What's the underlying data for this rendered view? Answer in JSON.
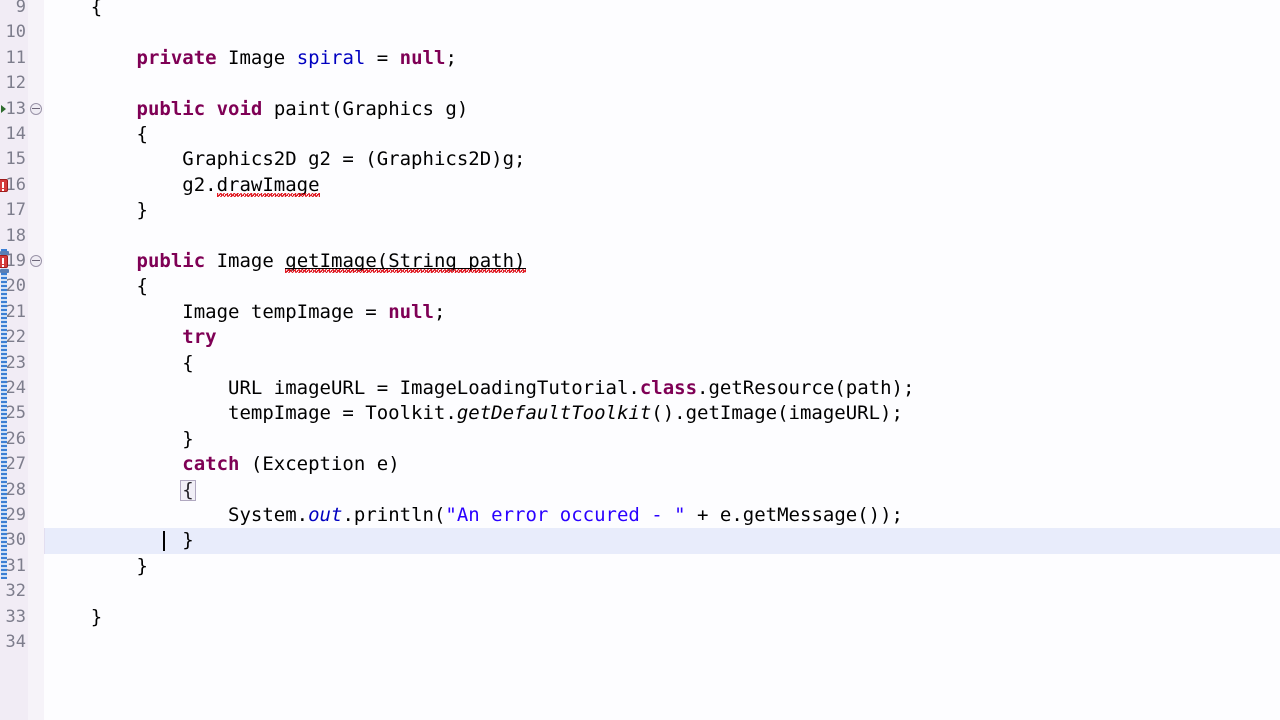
{
  "editor": {
    "app": "eclipse-java-editor",
    "language": "Java",
    "font_size_px": 19,
    "line_height_px": 25.4,
    "colors": {
      "background": "#fdfdff",
      "gutter_background": "#f1ecf5",
      "gutter_separator": "#e3dde9",
      "line_number": "#7d7d8c",
      "current_line_highlight": "#e8ecfb",
      "current_line_gutter": "#e2def0",
      "keyword": "#7f0055",
      "field": "#0000c0",
      "static_field": "#0000c0",
      "string": "#2a00ff",
      "plain_text": "#000000",
      "error_squiggle": "#e01b24",
      "error_marker": "#d43b3b",
      "change_bar": "#3b7fd4",
      "occurrence_marker": "#5a7fb5",
      "bracket_match_border": "#b0a8c0"
    },
    "current_line": 30,
    "caret_line": 30,
    "caret_column": 10,
    "change_bar_range": [
      19,
      31
    ]
  },
  "lines": [
    {
      "n": 9,
      "indent": 1,
      "tokens": [
        {
          "t": "{",
          "c": "plain"
        }
      ]
    },
    {
      "n": 10,
      "indent": 0,
      "tokens": []
    },
    {
      "n": 11,
      "indent": 2,
      "tokens": [
        {
          "t": "private",
          "c": "kw"
        },
        {
          "t": " ",
          "c": "plain"
        },
        {
          "t": "Image",
          "c": "plain"
        },
        {
          "t": " ",
          "c": "plain"
        },
        {
          "t": "spiral",
          "c": "field"
        },
        {
          "t": " = ",
          "c": "plain"
        },
        {
          "t": "null",
          "c": "kw"
        },
        {
          "t": ";",
          "c": "plain"
        }
      ]
    },
    {
      "n": 12,
      "indent": 0,
      "tokens": []
    },
    {
      "n": 13,
      "indent": 2,
      "fold": true,
      "arrow": true,
      "tokens": [
        {
          "t": "public",
          "c": "kw"
        },
        {
          "t": " ",
          "c": "plain"
        },
        {
          "t": "void",
          "c": "kw"
        },
        {
          "t": " ",
          "c": "plain"
        },
        {
          "t": "paint(Graphics g)",
          "c": "plain"
        }
      ]
    },
    {
      "n": 14,
      "indent": 2,
      "tokens": [
        {
          "t": "{",
          "c": "plain"
        }
      ]
    },
    {
      "n": 15,
      "indent": 3,
      "tokens": [
        {
          "t": "Graphics2D g2 = (Graphics2D)g;",
          "c": "plain"
        }
      ]
    },
    {
      "n": 16,
      "indent": 3,
      "error": true,
      "tokens": [
        {
          "t": "g2.",
          "c": "plain"
        },
        {
          "t": "drawImage",
          "c": "plain",
          "squiggle": true
        }
      ]
    },
    {
      "n": 17,
      "indent": 2,
      "tokens": [
        {
          "t": "}",
          "c": "plain"
        }
      ]
    },
    {
      "n": 18,
      "indent": 0,
      "tokens": []
    },
    {
      "n": 19,
      "indent": 2,
      "fold": true,
      "error": true,
      "occurrence": true,
      "tokens": [
        {
          "t": "public",
          "c": "kw"
        },
        {
          "t": " ",
          "c": "plain"
        },
        {
          "t": "Image",
          "c": "plain"
        },
        {
          "t": " ",
          "c": "plain"
        },
        {
          "t": "getImage(String path)",
          "c": "plain",
          "squiggle": true,
          "underline": true
        }
      ]
    },
    {
      "n": 20,
      "indent": 2,
      "tokens": [
        {
          "t": "{",
          "c": "plain"
        }
      ]
    },
    {
      "n": 21,
      "indent": 3,
      "tokens": [
        {
          "t": "Image tempImage = ",
          "c": "plain"
        },
        {
          "t": "null",
          "c": "kw"
        },
        {
          "t": ";",
          "c": "plain"
        }
      ]
    },
    {
      "n": 22,
      "indent": 3,
      "tokens": [
        {
          "t": "try",
          "c": "kw"
        }
      ]
    },
    {
      "n": 23,
      "indent": 3,
      "tokens": [
        {
          "t": "{",
          "c": "plain"
        }
      ]
    },
    {
      "n": 24,
      "indent": 4,
      "tokens": [
        {
          "t": "URL imageURL = ImageLoadingTutorial.",
          "c": "plain"
        },
        {
          "t": "class",
          "c": "kw"
        },
        {
          "t": ".getResource(path);",
          "c": "plain"
        }
      ]
    },
    {
      "n": 25,
      "indent": 4,
      "tokens": [
        {
          "t": "tempImage = Toolkit.",
          "c": "plain"
        },
        {
          "t": "getDefaultToolkit",
          "c": "smethod"
        },
        {
          "t": "().getImage(imageURL);",
          "c": "plain"
        }
      ]
    },
    {
      "n": 26,
      "indent": 3,
      "tokens": [
        {
          "t": "}",
          "c": "plain"
        }
      ]
    },
    {
      "n": 27,
      "indent": 3,
      "tokens": [
        {
          "t": "catch",
          "c": "kw"
        },
        {
          "t": " (Exception e)",
          "c": "plain"
        }
      ]
    },
    {
      "n": 28,
      "indent": 3,
      "bracket": true,
      "tokens": [
        {
          "t": "{",
          "c": "plain"
        }
      ]
    },
    {
      "n": 29,
      "indent": 4,
      "tokens": [
        {
          "t": "System.",
          "c": "plain"
        },
        {
          "t": "out",
          "c": "sfield"
        },
        {
          "t": ".println(",
          "c": "plain"
        },
        {
          "t": "\"An error occured - \"",
          "c": "str"
        },
        {
          "t": " + e.getMessage());",
          "c": "plain"
        }
      ]
    },
    {
      "n": 30,
      "indent": 3,
      "current": true,
      "tokens": [
        {
          "t": "}",
          "c": "plain"
        }
      ]
    },
    {
      "n": 31,
      "indent": 2,
      "tokens": [
        {
          "t": "}",
          "c": "plain"
        }
      ]
    },
    {
      "n": 32,
      "indent": 0,
      "tokens": []
    },
    {
      "n": 33,
      "indent": 1,
      "tokens": [
        {
          "t": "}",
          "c": "plain"
        }
      ]
    },
    {
      "n": 34,
      "indent": 0,
      "tokens": []
    }
  ]
}
